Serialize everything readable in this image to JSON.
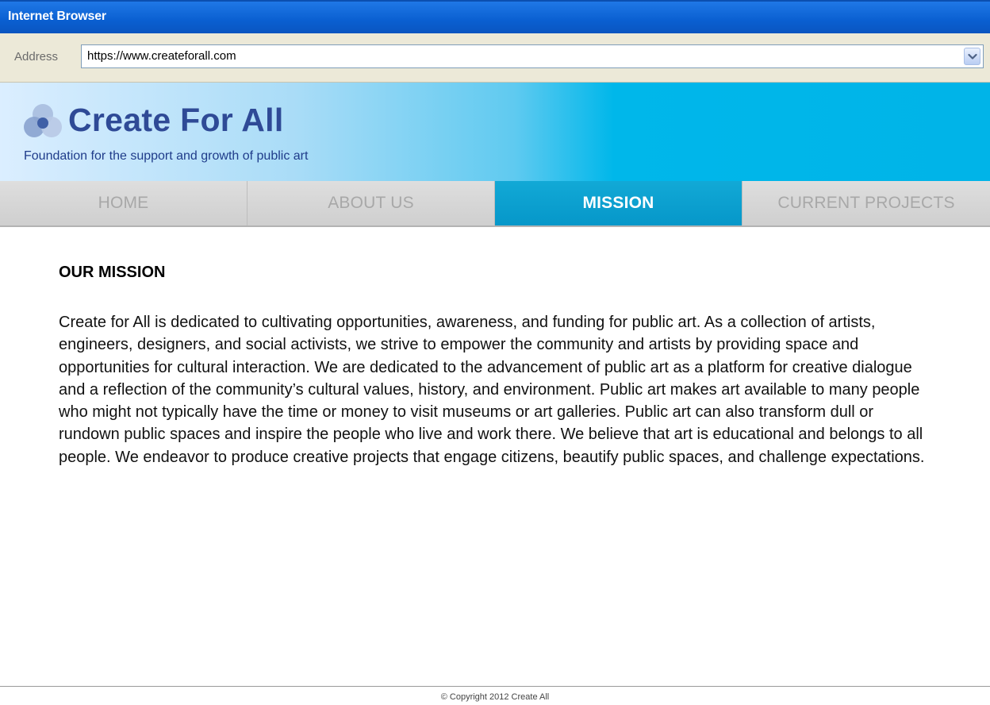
{
  "browser": {
    "window_title": "Internet Browser",
    "address_label": "Address",
    "url": "https://www.createforall.com"
  },
  "site": {
    "title": "Create For All",
    "tagline": "Foundation for the support and growth of public art"
  },
  "nav": {
    "items": [
      {
        "label": "HOME",
        "active": false
      },
      {
        "label": "ABOUT US",
        "active": false
      },
      {
        "label": "MISSION",
        "active": true
      },
      {
        "label": "CURRENT PROJECTS",
        "active": false
      }
    ]
  },
  "main": {
    "heading": "OUR MISSION",
    "body": "Create for All is dedicated to cultivating opportunities, awareness, and funding for public art. As a collection of artists, engineers, designers, and social activists, we strive to empower the community and artists by providing space and opportunities for cultural interaction. We are dedicated to the advancement of public art as a platform for creative dialogue and a reflection of the community’s cultural values, history, and environment. Public art makes art available to many people who might not typically have the time or money to visit museums or art galleries. Public art can also transform dull or rundown public spaces and inspire the people who live and work there. We believe that art is educational and belongs to all people. We endeavor to produce creative projects that engage citizens, beautify public spaces, and challenge expectations."
  },
  "footer": {
    "copyright": "© Copyright 2012 Create All"
  },
  "colors": {
    "titlebar": "#0a5fd1",
    "header_accent": "#00b7ea",
    "nav_active": "#0a9fcf",
    "site_title": "#2f4a96"
  },
  "icons": {
    "logo": "overlapping-circles-logo",
    "address_dropdown": "chevron-down-icon"
  }
}
